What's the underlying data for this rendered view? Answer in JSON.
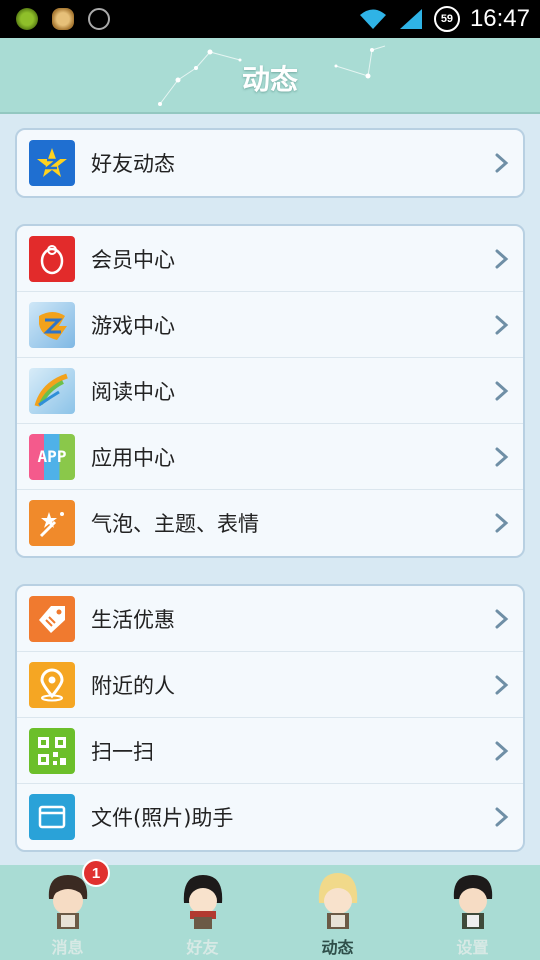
{
  "status_bar": {
    "time": "16:47",
    "battery_badge": "59",
    "icons": [
      "app-icon-green",
      "app-icon-burger",
      "signal-app-icon",
      "wifi-icon",
      "cell-signal-icon"
    ]
  },
  "header": {
    "title": "动态"
  },
  "groups": [
    {
      "items": [
        {
          "label": "好友动态",
          "icon": "qzone-star-icon",
          "color": "#1f6fd1"
        }
      ]
    },
    {
      "items": [
        {
          "label": "会员中心",
          "icon": "vip-penguin-icon",
          "color": "#e22b2b"
        },
        {
          "label": "游戏中心",
          "icon": "game-center-icon",
          "color": "#4aa0e8"
        },
        {
          "label": "阅读中心",
          "icon": "reading-feather-icon",
          "color": "#7fc2e6"
        },
        {
          "label": "应用中心",
          "icon": "app-center-icon",
          "color": "#f2a03c"
        },
        {
          "label": "气泡、主题、表情",
          "icon": "magic-wand-icon",
          "color": "#f08a2b"
        }
      ]
    },
    {
      "items": [
        {
          "label": "生活优惠",
          "icon": "coupon-tag-icon",
          "color": "#f07a2f"
        },
        {
          "label": "附近的人",
          "icon": "location-pin-icon",
          "color": "#f5a623"
        },
        {
          "label": "扫一扫",
          "icon": "qr-code-icon",
          "color": "#6cbf2a"
        },
        {
          "label": "文件(照片)助手",
          "icon": "folder-icon",
          "color": "#2aa2d8"
        }
      ]
    }
  ],
  "tabs": [
    {
      "label": "消息",
      "badge": "1",
      "active": false
    },
    {
      "label": "好友",
      "active": false
    },
    {
      "label": "动态",
      "active": true
    },
    {
      "label": "设置",
      "active": false
    }
  ]
}
